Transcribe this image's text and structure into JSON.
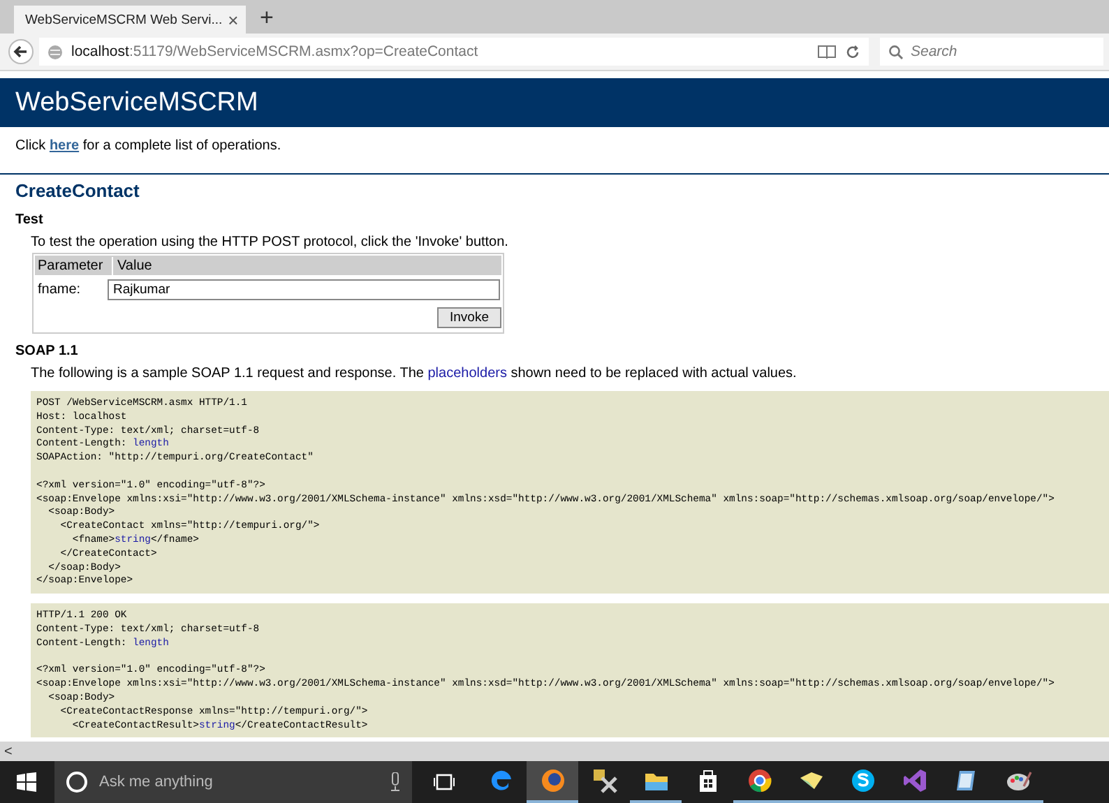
{
  "browser": {
    "tab": {
      "title": "WebServiceMSCRM Web Servi...",
      "close": "×"
    },
    "new_tab": "+",
    "url_host": "localhost",
    "url_rest": ":51179/WebServiceMSCRM.asmx?op=CreateContact",
    "search": {
      "placeholder": "Search"
    }
  },
  "page": {
    "banner": "WebServiceMSCRM",
    "intro": {
      "before": "Click ",
      "link": "here",
      "after": " for a complete list of operations."
    },
    "operation": "CreateContact",
    "test": {
      "heading": "Test",
      "instructions": "To test the operation using the HTTP POST protocol, click the 'Invoke' button.",
      "columns": [
        "Parameter",
        "Value"
      ],
      "params": [
        {
          "name": "fname:",
          "value": "Rajkumar"
        }
      ],
      "invoke": "Invoke"
    },
    "soap": {
      "heading": "SOAP 1.1",
      "note": {
        "before": "The following is a sample SOAP 1.1 request and response. The ",
        "link": "placeholders",
        "after": " shown need to be replaced with actual values."
      },
      "blocks": [
        {
          "groups": [
            [
              [
                {
                  "text": "POST /WebServiceMSCRM.asmx HTTP/1.1",
                  "kind": "literal"
                }
              ],
              [
                {
                  "text": "Host: localhost",
                  "kind": "literal"
                }
              ],
              [
                {
                  "text": "Content-Type: text/xml; charset=utf-8",
                  "kind": "literal"
                }
              ],
              [
                {
                  "text": "Content-Length: ",
                  "kind": "literal"
                },
                {
                  "text": "length",
                  "kind": "placeholder"
                }
              ],
              [
                {
                  "text": "SOAPAction: \"http://tempuri.org/CreateContact\"",
                  "kind": "literal"
                }
              ]
            ],
            [
              [
                {
                  "text": "<?xml version=\"1.0\" encoding=\"utf-8\"?>",
                  "kind": "literal"
                }
              ],
              [
                {
                  "text": "<soap:Envelope xmlns:xsi=\"http://www.w3.org/2001/XMLSchema-instance\" xmlns:xsd=\"http://www.w3.org/2001/XMLSchema\" xmlns:soap=\"http://schemas.xmlsoap.org/soap/envelope/\">",
                  "kind": "literal"
                }
              ],
              [
                {
                  "text": "  <soap:Body>",
                  "kind": "literal"
                }
              ],
              [
                {
                  "text": "    <CreateContact xmlns=\"http://tempuri.org/\">",
                  "kind": "literal"
                }
              ],
              [
                {
                  "text": "      <fname>",
                  "kind": "literal"
                },
                {
                  "text": "string",
                  "kind": "placeholder"
                },
                {
                  "text": "</fname>",
                  "kind": "literal"
                }
              ],
              [
                {
                  "text": "    </CreateContact>",
                  "kind": "literal"
                }
              ],
              [
                {
                  "text": "  </soap:Body>",
                  "kind": "literal"
                }
              ],
              [
                {
                  "text": "</soap:Envelope>",
                  "kind": "literal"
                }
              ]
            ]
          ]
        },
        {
          "groups": [
            [
              [
                {
                  "text": "HTTP/1.1 200 OK",
                  "kind": "literal"
                }
              ],
              [
                {
                  "text": "Content-Type: text/xml; charset=utf-8",
                  "kind": "literal"
                }
              ],
              [
                {
                  "text": "Content-Length: ",
                  "kind": "literal"
                },
                {
                  "text": "length",
                  "kind": "placeholder"
                }
              ]
            ],
            [
              [
                {
                  "text": "<?xml version=\"1.0\" encoding=\"utf-8\"?>",
                  "kind": "literal"
                }
              ],
              [
                {
                  "text": "<soap:Envelope xmlns:xsi=\"http://www.w3.org/2001/XMLSchema-instance\" xmlns:xsd=\"http://www.w3.org/2001/XMLSchema\" xmlns:soap=\"http://schemas.xmlsoap.org/soap/envelope/\">",
                  "kind": "literal"
                }
              ],
              [
                {
                  "text": "  <soap:Body>",
                  "kind": "literal"
                }
              ],
              [
                {
                  "text": "    <CreateContactResponse xmlns=\"http://tempuri.org/\">",
                  "kind": "literal"
                }
              ],
              [
                {
                  "text": "      <CreateContactResult>",
                  "kind": "literal"
                },
                {
                  "text": "string",
                  "kind": "placeholder"
                },
                {
                  "text": "</CreateContactResult>",
                  "kind": "literal"
                }
              ]
            ]
          ]
        }
      ]
    }
  },
  "scrollbar": {
    "left_arrow": "<"
  },
  "taskbar": {
    "search": {
      "placeholder": "Ask me anything"
    },
    "apps": [
      {
        "kind": "edge",
        "selected": false,
        "running": false
      },
      {
        "kind": "firefox",
        "selected": true,
        "running": true
      },
      {
        "kind": "tools",
        "selected": false,
        "running": false
      },
      {
        "kind": "folder",
        "selected": false,
        "running": true
      },
      {
        "kind": "store",
        "selected": false,
        "running": false
      },
      {
        "kind": "chrome",
        "selected": false,
        "running": true
      },
      {
        "kind": "notes",
        "selected": false,
        "running": true
      },
      {
        "kind": "skype",
        "selected": false,
        "running": true
      },
      {
        "kind": "vstudio",
        "selected": false,
        "running": true
      },
      {
        "kind": "notepad",
        "selected": false,
        "running": true
      },
      {
        "kind": "paint",
        "selected": false,
        "running": true
      }
    ]
  }
}
